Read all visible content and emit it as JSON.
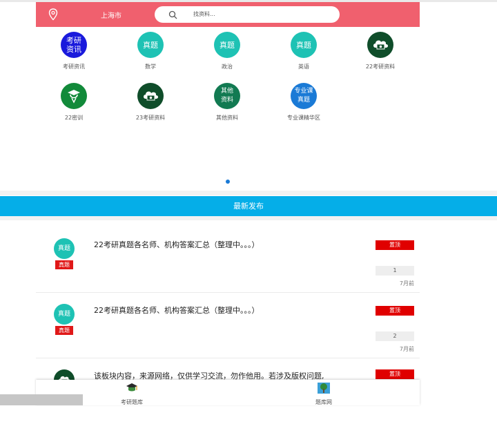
{
  "header": {
    "city": "上海市",
    "search_placeholder": "找资料...",
    "colors": {
      "header_bg": "#f0606e",
      "banner_bg": "#05aee8"
    }
  },
  "categories": [
    {
      "label": "考研资讯",
      "icon_text": "考研\n资讯",
      "icon": "text-circle",
      "color": "#1a1adc"
    },
    {
      "label": "数学",
      "icon_text": "真题",
      "icon": "text-circle",
      "color": "#1ec2b4"
    },
    {
      "label": "政治",
      "icon_text": "真题",
      "icon": "text-circle",
      "color": "#1ec2b4"
    },
    {
      "label": "英语",
      "icon_text": "真题",
      "icon": "text-circle",
      "color": "#1ec2b4"
    },
    {
      "label": "22考研资料",
      "icon_text": "",
      "icon": "cloud-money-icon",
      "color": "#0f4d2a"
    },
    {
      "label": "22密训",
      "icon_text": "",
      "icon": "graduate-icon",
      "color": "#128a3a"
    },
    {
      "label": "23考研资料",
      "icon_text": "",
      "icon": "cloud-money-icon",
      "color": "#0f4d2a"
    },
    {
      "label": "其他资料",
      "icon_text": "其他\n资料",
      "icon": "text-circle",
      "color": "#127a52"
    },
    {
      "label": "专业课精华区",
      "icon_text": "专业课\n真题",
      "icon": "text-circle",
      "color": "#1a7ad6"
    }
  ],
  "latest": {
    "heading": "最新发布",
    "items": [
      {
        "icon_text": "真题",
        "tag": "真题",
        "title": "22考研真题各名师、机构答案汇总（整理中。。。）",
        "pin": "置顶",
        "count": "1",
        "time": "7月前"
      },
      {
        "icon_text": "真题",
        "tag": "真题",
        "title": "22考研真题各名师、机构答案汇总（整理中。。。）",
        "pin": "置顶",
        "count": "2",
        "time": "7月前"
      },
      {
        "icon_text": "",
        "tag": "",
        "title": "该板块内容，来源网络，仅供学习交流，勿作他用。若涉及版权问题,",
        "pin": "置顶",
        "count": "",
        "time": ""
      }
    ]
  },
  "bottom_nav": [
    {
      "label": "考研题库",
      "icon": "graduation-cap-icon"
    },
    {
      "label": "题库网",
      "icon": "tree-icon"
    }
  ]
}
